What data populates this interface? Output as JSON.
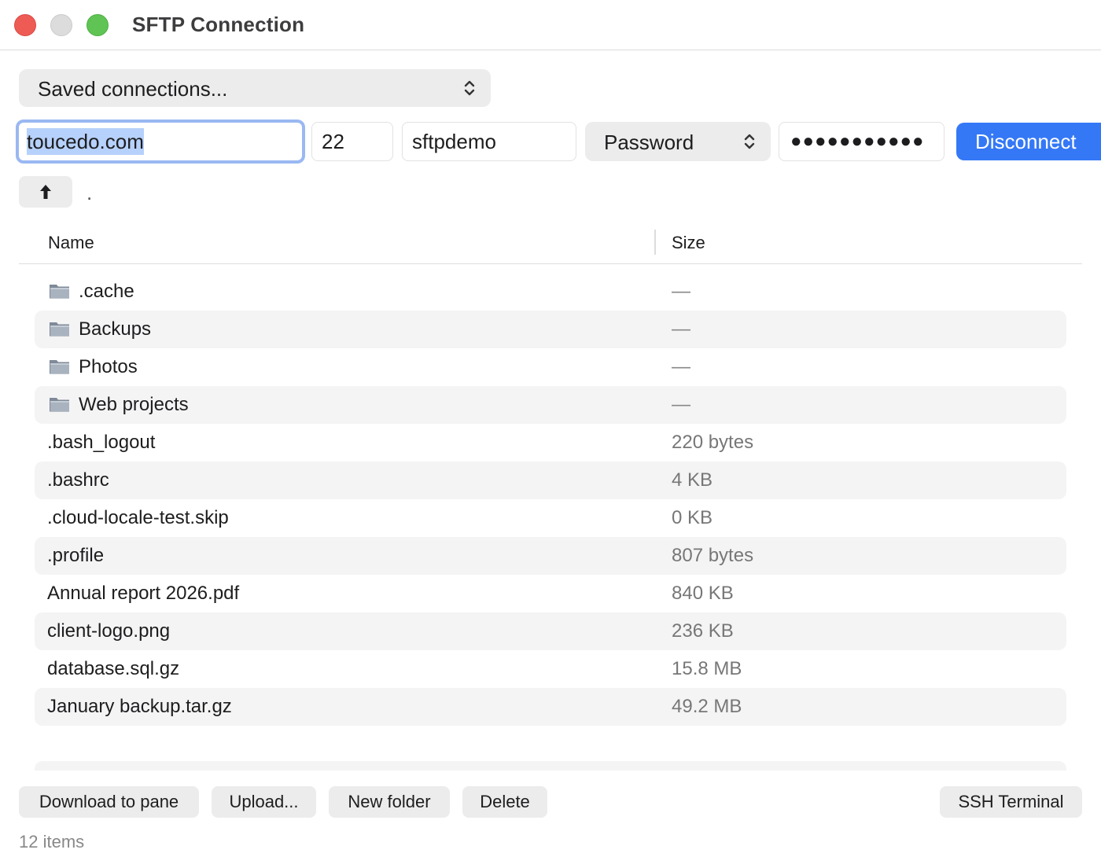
{
  "window": {
    "title": "SFTP Connection"
  },
  "connection": {
    "saved_label": "Saved connections...",
    "host": "toucedo.com",
    "port": "22",
    "username": "sftpdemo",
    "auth_method": "Password",
    "password_mask": "●●●●●●●●●●●",
    "disconnect_label": "Disconnect"
  },
  "navigation": {
    "current_path": "."
  },
  "table": {
    "columns": [
      "Name",
      "Size"
    ],
    "rows": [
      {
        "name": ".cache",
        "size": "—",
        "type": "folder"
      },
      {
        "name": "Backups",
        "size": "—",
        "type": "folder"
      },
      {
        "name": "Photos",
        "size": "—",
        "type": "folder"
      },
      {
        "name": "Web projects",
        "size": "—",
        "type": "folder"
      },
      {
        "name": ".bash_logout",
        "size": "220 bytes",
        "type": "file"
      },
      {
        "name": ".bashrc",
        "size": "4 KB",
        "type": "file"
      },
      {
        "name": ".cloud-locale-test.skip",
        "size": "0 KB",
        "type": "file"
      },
      {
        "name": ".profile",
        "size": "807 bytes",
        "type": "file"
      },
      {
        "name": "Annual report 2026.pdf",
        "size": "840 KB",
        "type": "file"
      },
      {
        "name": "client-logo.png",
        "size": "236 KB",
        "type": "file"
      },
      {
        "name": "database.sql.gz",
        "size": "15.8 MB",
        "type": "file"
      },
      {
        "name": "January backup.tar.gz",
        "size": "49.2 MB",
        "type": "file"
      }
    ]
  },
  "actions": {
    "download_label": "Download to pane",
    "upload_label": "Upload...",
    "new_folder_label": "New folder",
    "delete_label": "Delete",
    "ssh_label": "SSH Terminal"
  },
  "status": {
    "item_count": "12 items"
  },
  "colors": {
    "accent": "#3478f6",
    "focus_ring": "#9ab8f2",
    "selection": "#b6d1fb",
    "close": "#ee5b55",
    "minimize": "#dcdcdc",
    "maximize": "#5fc454"
  },
  "icons": {
    "folder": "folder-icon",
    "up": "arrow-up-icon",
    "popup": "chevron-up-down-icon"
  }
}
